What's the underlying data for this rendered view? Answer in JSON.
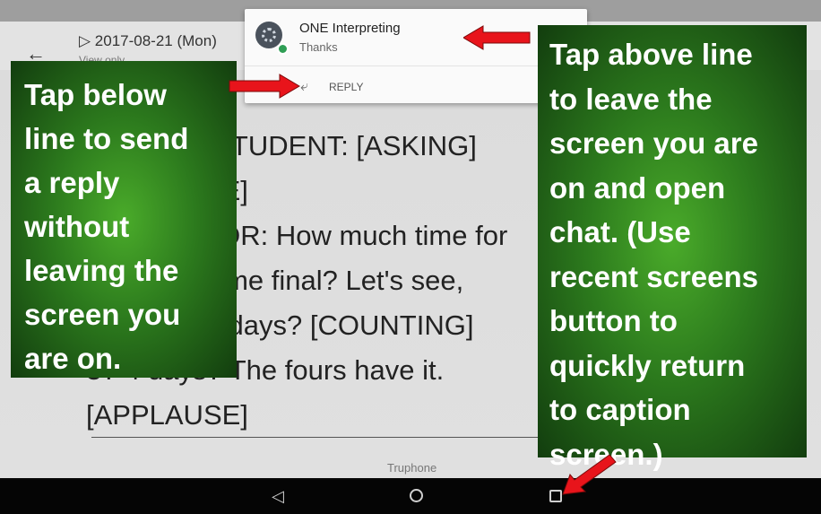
{
  "toolbar": {
    "date": "▷ 2017-08-21 (Mon)",
    "subtitle": "View only"
  },
  "notification": {
    "app_name": "ONE Interpreting",
    "message": "Thanks",
    "reply_label": "REPLY"
  },
  "caption": {
    "text": "[FEMALE STUDENT: [ASKING]\n[INAUDIBLE]\nPROFESSOR: How much time for\nthe take-home final? Let's see,\nyou want 2 days? [COUNTING]\n3? 4 days? The fours have it.\n[APPLAUSE]"
  },
  "footer": {
    "carrier": "Truphone"
  },
  "callouts": {
    "left": "Tap below\nline to send\na reply\nwithout\nleaving the\nscreen you\nare on.",
    "right": "Tap above line\nto leave the\nscreen you are\non and open\nchat. (Use\nrecent screens\nbutton to\nquickly return\nto caption\nscreen.)"
  },
  "colors": {
    "callout_green": "#2c7a1d",
    "arrow_red": "#e8141b",
    "navbar": "#050505"
  }
}
